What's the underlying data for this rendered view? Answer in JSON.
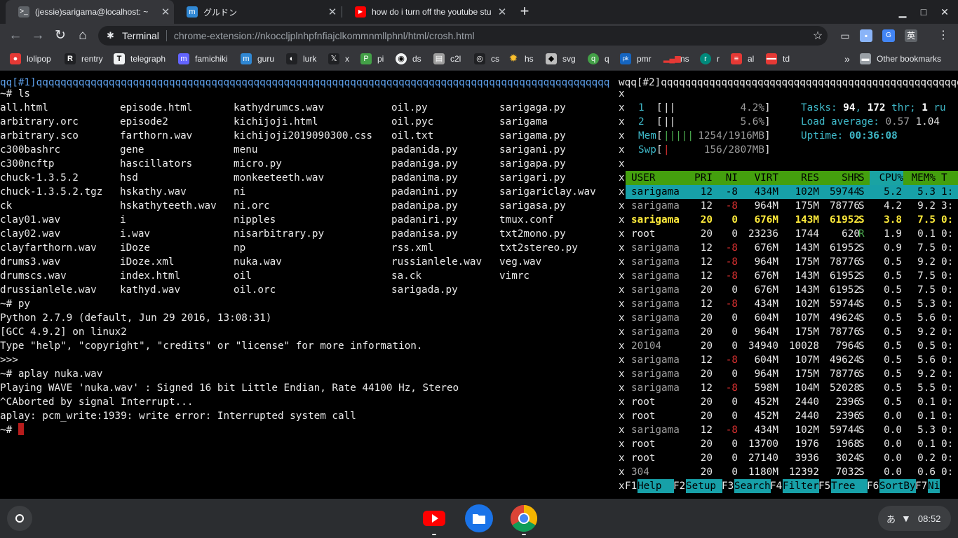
{
  "tabs": [
    {
      "title": "(jessie)sarigama@localhost: ~",
      "active": true
    },
    {
      "title": "グルドン",
      "active": false
    },
    {
      "title": "how do i turn off the youtube stu",
      "active": false
    }
  ],
  "window_controls": {
    "minimize": "▁",
    "maximize": "□",
    "close": "✕"
  },
  "toolbar": {
    "omnibox_chip": "Terminal",
    "url": "chrome-extension://nkoccljplnhpfnfiajclkommnmllphnl/html/crosh.html",
    "ime_label": "英"
  },
  "bookmarks": [
    {
      "label": "lolipop",
      "icon": "lollipop-icon",
      "color": "#e53935"
    },
    {
      "label": "rentry",
      "icon": "r-icon",
      "color": "#202124"
    },
    {
      "label": "telegraph",
      "icon": "t-icon",
      "color": "#f1f3f4"
    },
    {
      "label": "famichiki",
      "icon": "mastodon-icon",
      "color": "#6364ff"
    },
    {
      "label": "guru",
      "icon": "mastodon-icon",
      "color": "#3088d4"
    },
    {
      "label": "lurk",
      "icon": "lurk-icon",
      "color": "#202124"
    },
    {
      "label": "x",
      "icon": "x-icon",
      "color": "#202124"
    },
    {
      "label": "pi",
      "icon": "pi-icon",
      "color": "#43a047"
    },
    {
      "label": "ds",
      "icon": "ds-icon",
      "color": "#f1f3f4"
    },
    {
      "label": "c2l",
      "icon": "c2l-icon",
      "color": "#9e9e9e"
    },
    {
      "label": "cs",
      "icon": "cs-icon",
      "color": "#202124"
    },
    {
      "label": "hs",
      "icon": "sun-icon",
      "color": "#fbc02d"
    },
    {
      "label": "svg",
      "icon": "svg-icon",
      "color": "#bdbdbd"
    },
    {
      "label": "q",
      "icon": "q-icon",
      "color": "#43a047"
    },
    {
      "label": "pmr",
      "icon": "pmr-icon",
      "color": "#1565c0"
    },
    {
      "label": "ns",
      "icon": "bars-icon",
      "color": "#e53935"
    },
    {
      "label": "r",
      "icon": "r-circle-icon",
      "color": "#00897b"
    },
    {
      "label": "al",
      "icon": "al-icon",
      "color": "#e53935"
    },
    {
      "label": "td",
      "icon": "td-icon",
      "color": "#e53935"
    }
  ],
  "other_bookmarks": "Other bookmarks",
  "terminal": {
    "tmux_window1": "qq[#1]qqqqqqqqqqqqqqqqqqqqqqqqqqqqqqqqqqqqqqqqqqqqqqqqqqqqqqqqqqqqqqqqqqqqqqqqqqqqqqqqqqqqqqqqqqqqqqq",
    "tmux_window2": "wqq[#2]qqqqqqqqqqqqqqqqqqqqqqqqqqqqqqqqqqqqqqqqqqqqqqqqqqqqqqqqq",
    "ls_command": "~# ls",
    "ls_rows": [
      [
        "all.html",
        "episode.html",
        "kathydrumcs.wav",
        "oil.py",
        "sarigaga.py"
      ],
      [
        "arbitrary.orc",
        "episode2",
        "kichijoji.html",
        "oil.pyc",
        "sarigama"
      ],
      [
        "arbitrary.sco",
        "farthorn.wav",
        "kichijoji2019090300.css",
        "oil.txt",
        "sarigama.py"
      ],
      [
        "c300bashrc",
        "gene",
        "menu",
        "padanida.py",
        "sarigani.py"
      ],
      [
        "c300ncftp",
        "hascillators",
        "micro.py",
        "padaniga.py",
        "sarigapa.py"
      ],
      [
        "chuck-1.3.5.2",
        "hsd",
        "monkeeteeth.wav",
        "padanima.py",
        "sarigari.py"
      ],
      [
        "chuck-1.3.5.2.tgz",
        "hskathy.wav",
        "ni",
        "padanini.py",
        "sarigariclay.wav"
      ],
      [
        "ck",
        "hskathyteeth.wav",
        "ni.orc",
        "padanipa.py",
        "sarigasa.py"
      ],
      [
        "clay01.wav",
        "i",
        "nipples",
        "padaniri.py",
        "tmux.conf"
      ],
      [
        "clay02.wav",
        "i.wav",
        "nisarbitrary.py",
        "padanisa.py",
        "txt2mono.py"
      ],
      [
        "clayfarthorn.wav",
        "iDoze",
        "np",
        "rss.xml",
        "txt2stereo.py"
      ],
      [
        "drums3.wav",
        "iDoze.xml",
        "nuka.wav",
        "russianlele.wav",
        "veg.wav"
      ],
      [
        "drumscs.wav",
        "index.html",
        "oil",
        "sa.ck",
        "vimrc"
      ],
      [
        "drussianlele.wav",
        "kathyd.wav",
        "oil.orc",
        "sarigada.py",
        ""
      ]
    ],
    "after_lines": [
      "~# py",
      "Python 2.7.9 (default, Jun 29 2016, 13:08:31)",
      "[GCC 4.9.2] on linux2",
      "Type \"help\", \"copyright\", \"credits\" or \"license\" for more information.",
      ">>>",
      "~# aplay nuka.wav",
      "Playing WAVE 'nuka.wav' : Signed 16 bit Little Endian, Rate 44100 Hz, Stereo",
      "^CAborted by signal Interrupt...",
      "aplay: pcm_write:1939: write error: Interrupted system call"
    ],
    "prompt": "~# ",
    "divider_char": "x"
  },
  "htop": {
    "cpu_meters": [
      {
        "label": "1",
        "bar": "||",
        "value": "4.2%"
      },
      {
        "label": "2",
        "bar": "||",
        "value": "5.6%"
      }
    ],
    "mem": {
      "label": "Mem",
      "bar": "|||||",
      "value": "1254/1916MB"
    },
    "swp": {
      "label": "Swp",
      "bar": "|",
      "value": "156/2807MB"
    },
    "tasks": {
      "label": "Tasks: ",
      "count": "94",
      "sep": ", ",
      "threads": "172",
      "thr_label": " thr; ",
      "running": "1",
      "run_label": " ru"
    },
    "load": {
      "label": "Load average: ",
      "v1": "0.57",
      "v2": "1.04"
    },
    "uptime": {
      "label": "Uptime: ",
      "value": "00:36:08"
    },
    "columns": [
      "USER",
      "PRI",
      "NI",
      "VIRT",
      "RES",
      "SHR",
      "S",
      "CPU%",
      "MEM%",
      "T"
    ],
    "processes": [
      [
        "sarigama",
        "12",
        "-8",
        "434M",
        "102M",
        "59744",
        "S",
        "5.2",
        "5.3",
        "1:"
      ],
      [
        "sarigama",
        "12",
        "-8",
        "964M",
        "175M",
        "78776",
        "S",
        "4.2",
        "9.2",
        "3:"
      ],
      [
        "sarigama",
        "20",
        "0",
        "676M",
        "143M",
        "61952",
        "S",
        "3.8",
        "7.5",
        "0:"
      ],
      [
        "root",
        "20",
        "0",
        "23236",
        "1744",
        "620",
        "R",
        "1.9",
        "0.1",
        "0:"
      ],
      [
        "sarigama",
        "12",
        "-8",
        "676M",
        "143M",
        "61952",
        "S",
        "0.9",
        "7.5",
        "0:"
      ],
      [
        "sarigama",
        "12",
        "-8",
        "964M",
        "175M",
        "78776",
        "S",
        "0.5",
        "9.2",
        "0:"
      ],
      [
        "sarigama",
        "12",
        "-8",
        "676M",
        "143M",
        "61952",
        "S",
        "0.5",
        "7.5",
        "0:"
      ],
      [
        "sarigama",
        "20",
        "0",
        "676M",
        "143M",
        "61952",
        "S",
        "0.5",
        "7.5",
        "0:"
      ],
      [
        "sarigama",
        "12",
        "-8",
        "434M",
        "102M",
        "59744",
        "S",
        "0.5",
        "5.3",
        "0:"
      ],
      [
        "sarigama",
        "20",
        "0",
        "604M",
        "107M",
        "49624",
        "S",
        "0.5",
        "5.6",
        "0:"
      ],
      [
        "sarigama",
        "20",
        "0",
        "964M",
        "175M",
        "78776",
        "S",
        "0.5",
        "9.2",
        "0:"
      ],
      [
        "20104",
        "20",
        "0",
        "34940",
        "10028",
        "7964",
        "S",
        "0.5",
        "0.5",
        "0:"
      ],
      [
        "sarigama",
        "12",
        "-8",
        "604M",
        "107M",
        "49624",
        "S",
        "0.5",
        "5.6",
        "0:"
      ],
      [
        "sarigama",
        "20",
        "0",
        "964M",
        "175M",
        "78776",
        "S",
        "0.5",
        "9.2",
        "0:"
      ],
      [
        "sarigama",
        "12",
        "-8",
        "598M",
        "104M",
        "52028",
        "S",
        "0.5",
        "5.5",
        "0:"
      ],
      [
        "root",
        "20",
        "0",
        "452M",
        "2440",
        "2396",
        "S",
        "0.5",
        "0.1",
        "0:"
      ],
      [
        "root",
        "20",
        "0",
        "452M",
        "2440",
        "2396",
        "S",
        "0.0",
        "0.1",
        "0:"
      ],
      [
        "sarigama",
        "12",
        "-8",
        "434M",
        "102M",
        "59744",
        "S",
        "0.0",
        "5.3",
        "0:"
      ],
      [
        "root",
        "20",
        "0",
        "13700",
        "1976",
        "1968",
        "S",
        "0.0",
        "0.1",
        "0:"
      ],
      [
        "root",
        "20",
        "0",
        "27140",
        "3936",
        "3024",
        "S",
        "0.0",
        "0.2",
        "0:"
      ],
      [
        "304",
        "20",
        "0",
        "1180M",
        "12392",
        "7032",
        "S",
        "0.0",
        "0.6",
        "0:"
      ]
    ],
    "fkeys": [
      {
        "key": "F1",
        "label": "Help  "
      },
      {
        "key": "F2",
        "label": "Setup "
      },
      {
        "key": "F3",
        "label": "Search"
      },
      {
        "key": "F4",
        "label": "Filter"
      },
      {
        "key": "F5",
        "label": "Tree  "
      },
      {
        "key": "F6",
        "label": "SortBy"
      },
      {
        "key": "F7",
        "label": "Ni"
      }
    ]
  },
  "shelf": {
    "apps": [
      {
        "name": "youtube",
        "color": "#ff0000"
      },
      {
        "name": "files",
        "color": "#1a73e8"
      },
      {
        "name": "chrome",
        "color": "#4285f4"
      }
    ],
    "ime": "あ",
    "time": "08:52"
  },
  "colors": {
    "terminal_bg": "#000000",
    "htop_header": "#44a00e",
    "htop_selection": "#17a0a8",
    "tmux_active": "#5c9ee8",
    "cursor": "#b71c1c"
  }
}
